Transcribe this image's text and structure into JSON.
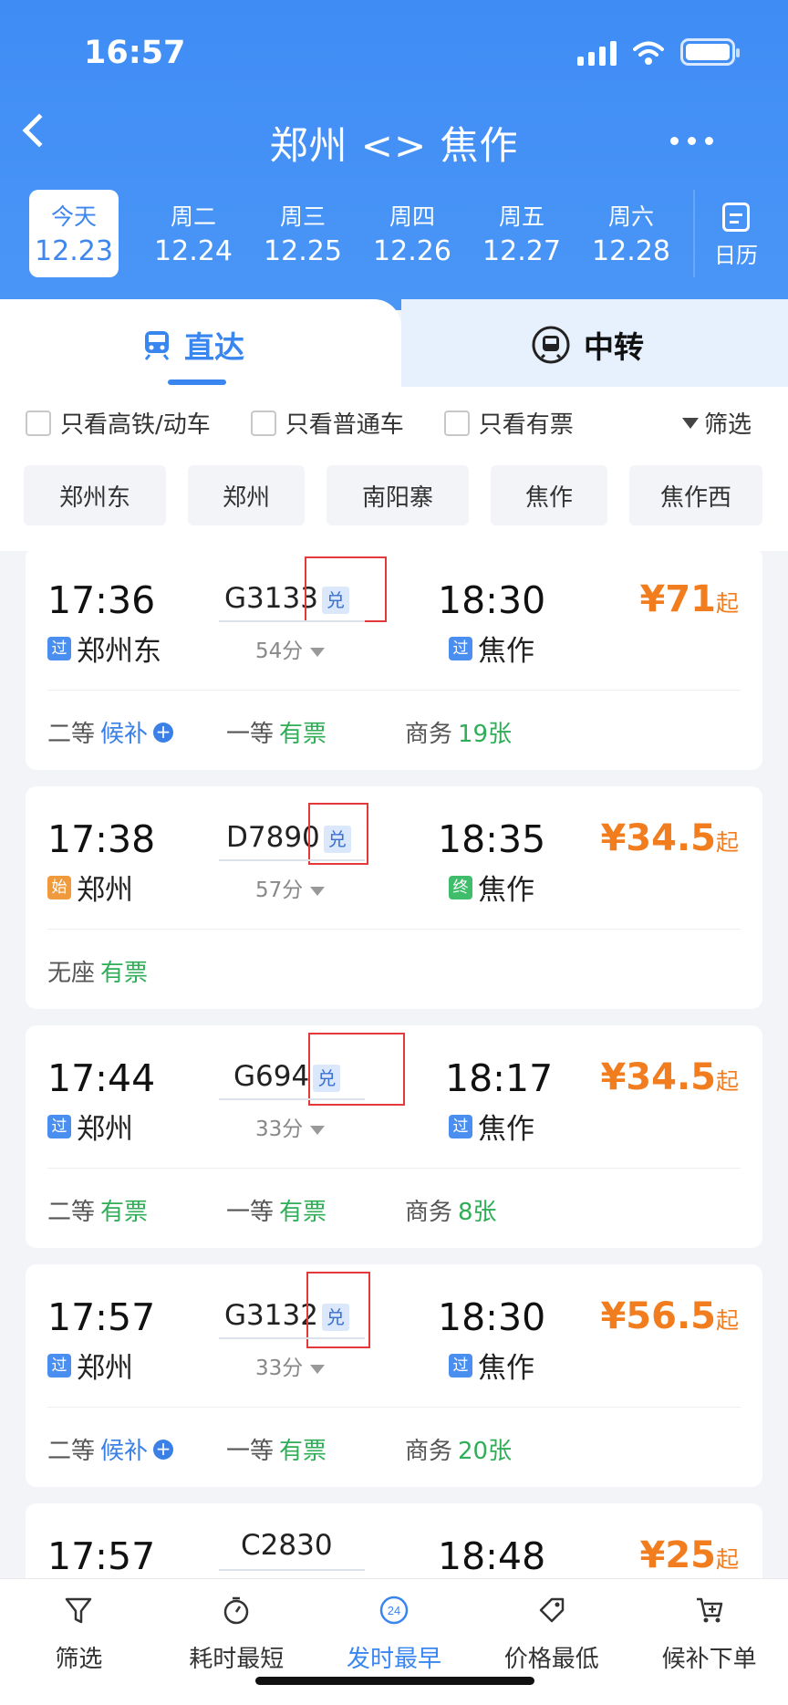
{
  "status": {
    "time": "16:57"
  },
  "header": {
    "title": "郑州 <> 焦作"
  },
  "dates": [
    {
      "weekday": "今天",
      "date": "12.23",
      "active": true
    },
    {
      "weekday": "周二",
      "date": "12.24"
    },
    {
      "weekday": "周三",
      "date": "12.25"
    },
    {
      "weekday": "周四",
      "date": "12.26"
    },
    {
      "weekday": "周五",
      "date": "12.27"
    },
    {
      "weekday": "周六",
      "date": "12.28"
    }
  ],
  "calendar_label": "日历",
  "tabs": {
    "direct": "直达",
    "transfer": "中转"
  },
  "filters": {
    "high_speed": "只看高铁/动车",
    "normal": "只看普通车",
    "available": "只看有票",
    "filter": "筛选"
  },
  "stations": [
    "郑州东",
    "郑州",
    "南阳寨",
    "焦作",
    "焦作西"
  ],
  "exchange_badge": "兑",
  "trains": [
    {
      "dep": "17:36",
      "num": "G3133",
      "arr": "18:30",
      "dur": "54分",
      "from_tag": "过",
      "from": "郑州东",
      "to_tag": "过",
      "to": "焦作",
      "price": "¥71",
      "price_suffix": "起",
      "seats": [
        {
          "name": "二等",
          "status": "候补",
          "plus": "+"
        },
        {
          "name": "一等",
          "status": "有票"
        },
        {
          "name": "商务",
          "status": "19张"
        }
      ]
    },
    {
      "dep": "17:38",
      "num": "D7890",
      "arr": "18:35",
      "dur": "57分",
      "from_tag": "始",
      "from": "郑州",
      "to_tag": "终",
      "to": "焦作",
      "price": "¥34.5",
      "price_suffix": "起",
      "seats": [
        {
          "name": "无座",
          "status": "有票"
        }
      ]
    },
    {
      "dep": "17:44",
      "num": "G694",
      "arr": "18:17",
      "dur": "33分",
      "from_tag": "过",
      "from": "郑州",
      "to_tag": "过",
      "to": "焦作",
      "price": "¥34.5",
      "price_suffix": "起",
      "seats": [
        {
          "name": "二等",
          "status": "有票"
        },
        {
          "name": "一等",
          "status": "有票"
        },
        {
          "name": "商务",
          "status": "8张"
        }
      ]
    },
    {
      "dep": "17:57",
      "num": "G3132",
      "arr": "18:30",
      "dur": "33分",
      "from_tag": "过",
      "from": "郑州",
      "to_tag": "过",
      "to": "焦作",
      "price": "¥56.5",
      "price_suffix": "起",
      "seats": [
        {
          "name": "二等",
          "status": "候补",
          "plus": "+"
        },
        {
          "name": "一等",
          "status": "有票"
        },
        {
          "name": "商务",
          "status": "20张"
        }
      ]
    },
    {
      "dep": "17:57",
      "num": "C2830",
      "arr": "18:48",
      "price": "¥25",
      "price_suffix": "起"
    }
  ],
  "bottom": [
    {
      "label": "筛选"
    },
    {
      "label": "耗时最短"
    },
    {
      "label": "发时最早",
      "badge": "24",
      "active": true
    },
    {
      "label": "价格最低"
    },
    {
      "label": "候补下单"
    }
  ]
}
